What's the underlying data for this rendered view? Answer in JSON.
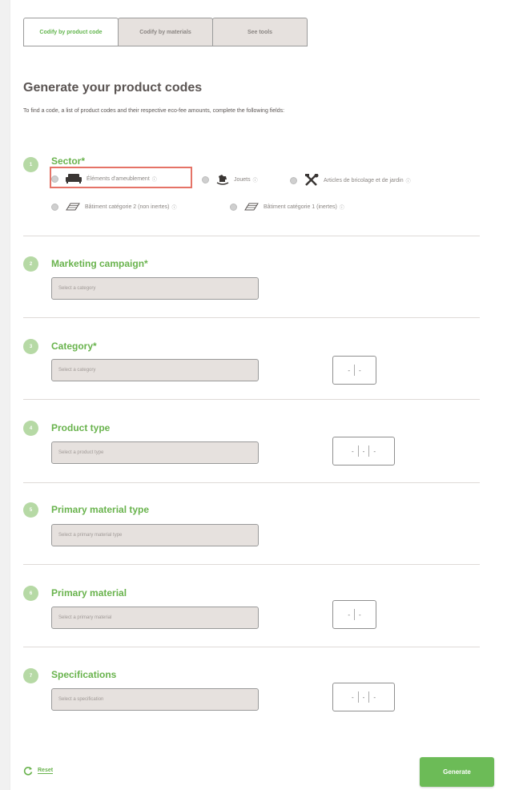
{
  "tabs": [
    {
      "label": "Codify by product code",
      "active": true
    },
    {
      "label": "Codify by materials",
      "active": false
    },
    {
      "label": "See tools",
      "active": false
    }
  ],
  "header": {
    "title": "Generate your product codes",
    "intro": "To find a code, a list of product codes and their respective eco-fee amounts, complete the following fields:"
  },
  "sections": [
    {
      "number": "1",
      "title": "Sector*"
    },
    {
      "number": "2",
      "title": "Marketing campaign*",
      "placeholder": "Select a category"
    },
    {
      "number": "3",
      "title": "Category*",
      "placeholder": "Select a category",
      "code": [
        "-",
        "-"
      ]
    },
    {
      "number": "4",
      "title": "Product type",
      "placeholder": "Select a product type",
      "code": [
        "-",
        "-",
        "-"
      ]
    },
    {
      "number": "5",
      "title": "Primary material type",
      "placeholder": "Select a primary material type"
    },
    {
      "number": "6",
      "title": "Primary material",
      "placeholder": "Select a primary material",
      "code": [
        "-",
        "-"
      ]
    },
    {
      "number": "7",
      "title": "Specifications",
      "placeholder": "Select a specification",
      "code": [
        "-",
        "-",
        "-"
      ]
    }
  ],
  "sectors": [
    {
      "label": "Éléments d'ameublement",
      "icon": "sofa-icon",
      "info": "ⓘ"
    },
    {
      "label": "Jouets",
      "icon": "rocking-horse-icon",
      "info": "ⓘ"
    },
    {
      "label": "Articles de bricolage et de jardin",
      "icon": "tools-icon",
      "info": "ⓘ"
    },
    {
      "label": "Bâtiment catégorie 2 (non inertes)",
      "icon": "brick-icon",
      "info": "ⓘ"
    },
    {
      "label": "Bâtiment catégorie 1 (inertes)",
      "icon": "brick-icon",
      "info": "ⓘ"
    }
  ],
  "footer": {
    "reset_label": "Reset",
    "generate_label": "Generate"
  },
  "colors": {
    "accent_green": "#69b34d",
    "badge_green": "#b6d9a5",
    "highlight_red": "#e57367"
  }
}
